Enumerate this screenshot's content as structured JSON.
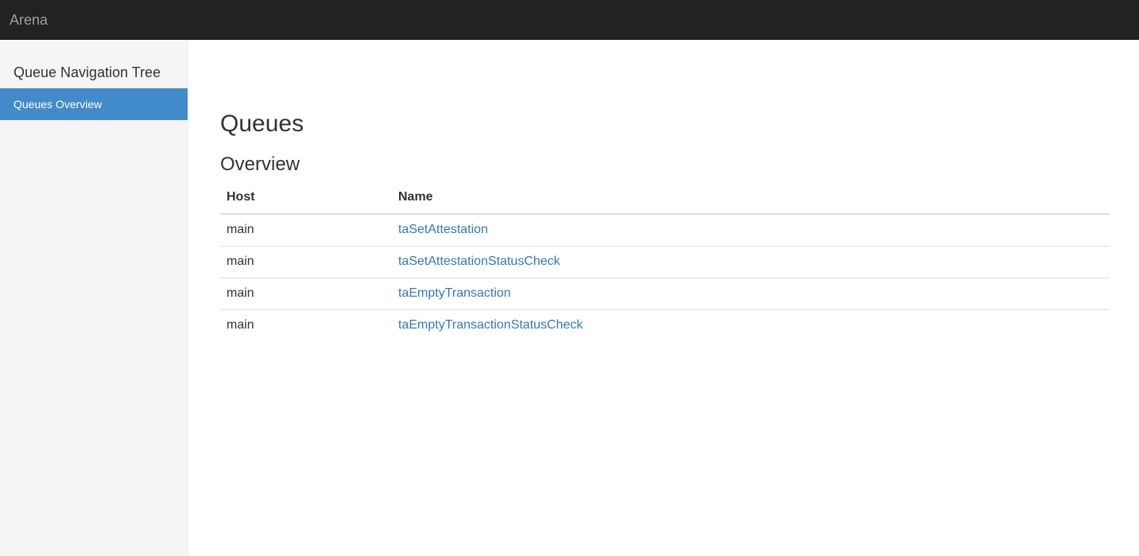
{
  "navbar": {
    "brand": "Arena"
  },
  "sidebar": {
    "title": "Queue Navigation Tree",
    "items": [
      {
        "label": "Queues Overview",
        "active": true
      }
    ],
    "active_color": "#428bca"
  },
  "main": {
    "title": "Queues",
    "section_title": "Overview",
    "table": {
      "headers": [
        "Host",
        "Name"
      ],
      "rows": [
        {
          "host": "main",
          "name": "taSetAttestation"
        },
        {
          "host": "main",
          "name": "taSetAttestationStatusCheck"
        },
        {
          "host": "main",
          "name": "taEmptyTransaction"
        },
        {
          "host": "main",
          "name": "taEmptyTransactionStatusCheck"
        }
      ]
    }
  },
  "colors": {
    "navbar_bg": "#222222",
    "link": "#337ab7"
  }
}
